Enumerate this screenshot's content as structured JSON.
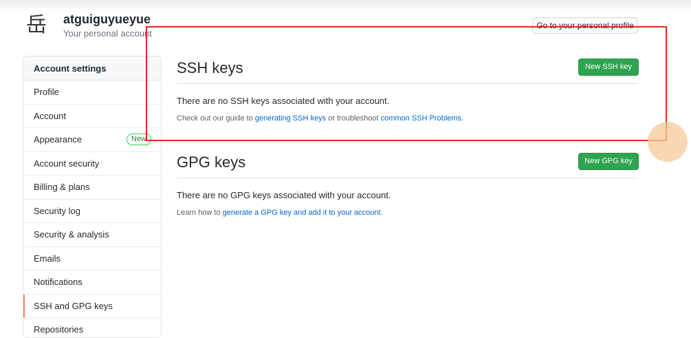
{
  "user": {
    "avatar_glyph": "岳",
    "username": "atguiguyueyue",
    "subtitle": "Your personal account",
    "profile_button": "Go to your personal profile"
  },
  "sidebar": {
    "header": "Account settings",
    "items": [
      {
        "label": "Profile"
      },
      {
        "label": "Account"
      },
      {
        "label": "Appearance",
        "badge": "New"
      },
      {
        "label": "Account security"
      },
      {
        "label": "Billing & plans"
      },
      {
        "label": "Security log"
      },
      {
        "label": "Security & analysis"
      },
      {
        "label": "Emails"
      },
      {
        "label": "Notifications"
      },
      {
        "label": "SSH and GPG keys",
        "selected": true
      },
      {
        "label": "Repositories"
      }
    ]
  },
  "ssh": {
    "title": "SSH keys",
    "button": "New SSH key",
    "empty": "There are no SSH keys associated with your account.",
    "hint_prefix": "Check out our guide to ",
    "hint_link1": "generating SSH keys",
    "hint_middle": " or troubleshoot ",
    "hint_link2": "common SSH Problems",
    "hint_suffix": "."
  },
  "gpg": {
    "title": "GPG keys",
    "button": "New GPG key",
    "empty": "There are no GPG keys associated with your account.",
    "hint_prefix": "Learn how to ",
    "hint_link": "generate a GPG key and add it to your account",
    "hint_suffix": "."
  },
  "colors": {
    "accent_green": "#2ea44f",
    "link_blue": "#0366d6",
    "selected_marker": "#f9826c",
    "annotation_red": "#e8291c"
  }
}
